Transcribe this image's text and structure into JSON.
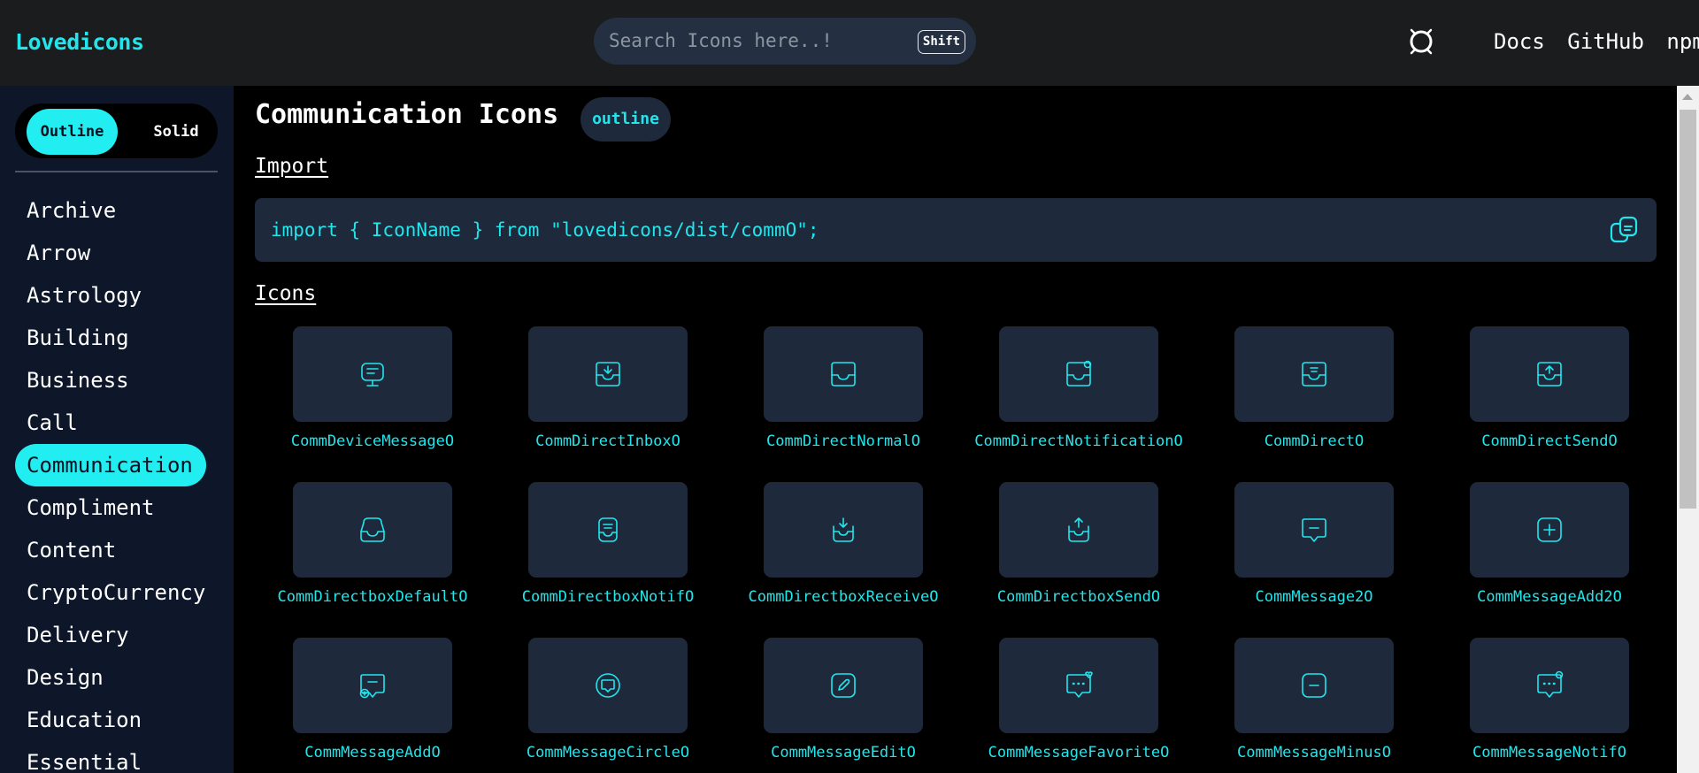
{
  "header": {
    "logo": "Lovedicons",
    "search_placeholder": "Search Icons here..!",
    "shortcut": "Shift",
    "theme_icon": "theme-toggle-icon",
    "nav": [
      "Docs",
      "GitHub",
      "npm"
    ]
  },
  "sidebar": {
    "toggle": {
      "outline": "Outline",
      "solid": "Solid",
      "selected": "Outline"
    },
    "categories": [
      "Archive",
      "Arrow",
      "Astrology",
      "Building",
      "Business",
      "Call",
      "Communication",
      "Compliment",
      "Content",
      "CryptoCurrency",
      "Delivery",
      "Design",
      "Education",
      "Essential"
    ],
    "active_category": "Communication"
  },
  "main": {
    "title": "Communication Icons",
    "variant_badge": "outline",
    "import_heading": "Import",
    "import_code": "import { IconName } from \"lovedicons/dist/commO\";",
    "icons_heading": "Icons",
    "icons": [
      "CommDeviceMessageO",
      "CommDirectInboxO",
      "CommDirectNormalO",
      "CommDirectNotificationO",
      "CommDirectO",
      "CommDirectSendO",
      "CommDirectboxDefaultO",
      "CommDirectboxNotifO",
      "CommDirectboxReceiveO",
      "CommDirectboxSendO",
      "CommMessage2O",
      "CommMessageAdd2O",
      "CommMessageAddO",
      "CommMessageCircleO",
      "CommMessageEditO",
      "CommMessageFavoriteO",
      "CommMessageMinusO",
      "CommMessageNotifO"
    ]
  },
  "colors": {
    "accent": "#22eef2",
    "header_bg": "#1b1c1e",
    "sidebar_bg": "#0e1729",
    "tile_bg": "#1e293b",
    "page_bg": "#000000"
  }
}
